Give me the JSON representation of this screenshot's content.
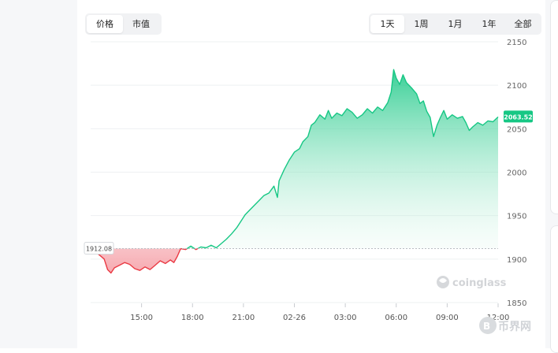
{
  "mode_tabs": [
    {
      "label": "价格",
      "active": true
    },
    {
      "label": "市值",
      "active": false
    }
  ],
  "range_tabs": [
    {
      "label": "1天",
      "active": true
    },
    {
      "label": "1周",
      "active": false
    },
    {
      "label": "1月",
      "active": false
    },
    {
      "label": "1年",
      "active": false
    },
    {
      "label": "全部",
      "active": false
    }
  ],
  "colors": {
    "up": "#16c784",
    "down": "#ea3943",
    "up_fill": "#d2f4e4",
    "down_fill": "#f6a6ad",
    "badge": "#16c784"
  },
  "watermark": "coinglass",
  "corner_logo": "币界网",
  "chart_data": {
    "type": "area",
    "baseline": 1912.08,
    "baseline_label": "1912.08",
    "last_label": "2063.52",
    "ylim": [
      1850,
      2150
    ],
    "yticks": [
      1850,
      1900,
      1950,
      2000,
      2050,
      2100,
      2150
    ],
    "xticks": [
      {
        "label": "15:00",
        "t": 3
      },
      {
        "label": "18:00",
        "t": 6
      },
      {
        "label": "21:00",
        "t": 9
      },
      {
        "label": "02-26",
        "t": 12
      },
      {
        "label": "03:00",
        "t": 15
      },
      {
        "label": "06:00",
        "t": 18
      },
      {
        "label": "09:00",
        "t": 21
      },
      {
        "label": "12:00",
        "t": 24
      }
    ],
    "points": [
      [
        0,
        1912
      ],
      [
        0.5,
        1905
      ],
      [
        0.8,
        1900
      ],
      [
        1.0,
        1888
      ],
      [
        1.2,
        1884
      ],
      [
        1.4,
        1890
      ],
      [
        1.7,
        1893
      ],
      [
        2.0,
        1896
      ],
      [
        2.3,
        1894
      ],
      [
        2.6,
        1889
      ],
      [
        2.9,
        1887
      ],
      [
        3.2,
        1891
      ],
      [
        3.5,
        1888
      ],
      [
        3.8,
        1893
      ],
      [
        4.1,
        1898
      ],
      [
        4.4,
        1895
      ],
      [
        4.7,
        1899
      ],
      [
        4.9,
        1896
      ],
      [
        5.1,
        1903
      ],
      [
        5.3,
        1912
      ],
      [
        5.6,
        1911
      ],
      [
        5.9,
        1915
      ],
      [
        6.2,
        1911
      ],
      [
        6.5,
        1914
      ],
      [
        6.8,
        1913
      ],
      [
        7.1,
        1916
      ],
      [
        7.4,
        1913
      ],
      [
        7.7,
        1918
      ],
      [
        8.0,
        1923
      ],
      [
        8.3,
        1929
      ],
      [
        8.6,
        1936
      ],
      [
        8.9,
        1945
      ],
      [
        9.1,
        1951
      ],
      [
        9.3,
        1955
      ],
      [
        9.6,
        1961
      ],
      [
        9.9,
        1967
      ],
      [
        10.2,
        1973
      ],
      [
        10.5,
        1976
      ],
      [
        10.8,
        1984
      ],
      [
        11.0,
        1971
      ],
      [
        11.1,
        1990
      ],
      [
        11.4,
        2003
      ],
      [
        11.7,
        2014
      ],
      [
        12.0,
        2023
      ],
      [
        12.3,
        2027
      ],
      [
        12.5,
        2035
      ],
      [
        12.8,
        2041
      ],
      [
        13.0,
        2054
      ],
      [
        13.2,
        2057
      ],
      [
        13.5,
        2066
      ],
      [
        13.8,
        2061
      ],
      [
        14.0,
        2071
      ],
      [
        14.2,
        2062
      ],
      [
        14.5,
        2068
      ],
      [
        14.8,
        2065
      ],
      [
        15.1,
        2073
      ],
      [
        15.4,
        2069
      ],
      [
        15.7,
        2062
      ],
      [
        16.0,
        2066
      ],
      [
        16.3,
        2073
      ],
      [
        16.6,
        2068
      ],
      [
        16.9,
        2075
      ],
      [
        17.2,
        2071
      ],
      [
        17.5,
        2080
      ],
      [
        17.7,
        2092
      ],
      [
        17.85,
        2118
      ],
      [
        18.0,
        2108
      ],
      [
        18.2,
        2101
      ],
      [
        18.4,
        2112
      ],
      [
        18.6,
        2103
      ],
      [
        18.9,
        2097
      ],
      [
        19.2,
        2090
      ],
      [
        19.4,
        2079
      ],
      [
        19.6,
        2082
      ],
      [
        19.8,
        2070
      ],
      [
        20.0,
        2063
      ],
      [
        20.2,
        2041
      ],
      [
        20.4,
        2054
      ],
      [
        20.6,
        2063
      ],
      [
        20.8,
        2071
      ],
      [
        21.0,
        2061
      ],
      [
        21.3,
        2066
      ],
      [
        21.6,
        2062
      ],
      [
        21.9,
        2064
      ],
      [
        22.1,
        2057
      ],
      [
        22.3,
        2048
      ],
      [
        22.5,
        2052
      ],
      [
        22.8,
        2057
      ],
      [
        23.1,
        2054
      ],
      [
        23.4,
        2059
      ],
      [
        23.7,
        2058
      ],
      [
        24.0,
        2063.52
      ]
    ]
  }
}
